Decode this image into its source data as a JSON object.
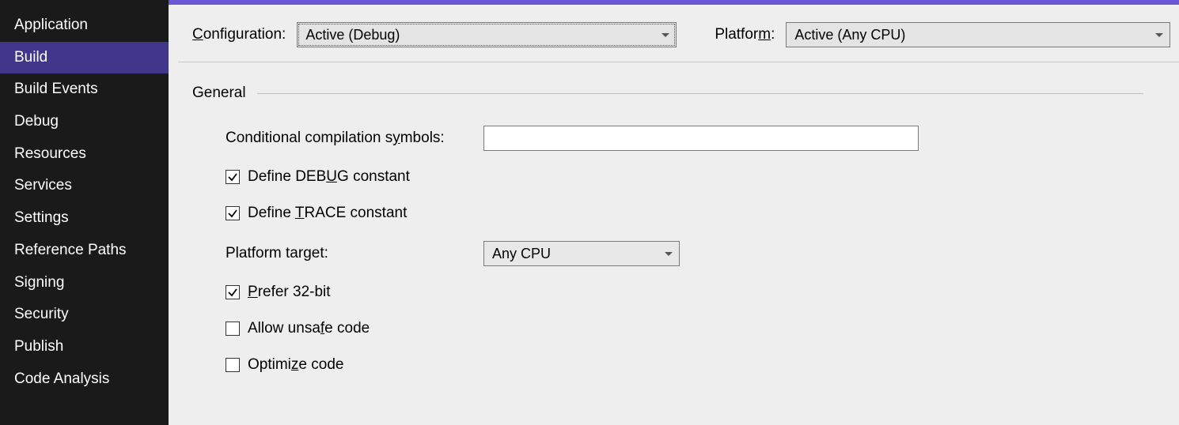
{
  "sidebar": {
    "items": [
      {
        "label": "Application",
        "active": false
      },
      {
        "label": "Build",
        "active": true
      },
      {
        "label": "Build Events",
        "active": false
      },
      {
        "label": "Debug",
        "active": false
      },
      {
        "label": "Resources",
        "active": false
      },
      {
        "label": "Services",
        "active": false
      },
      {
        "label": "Settings",
        "active": false
      },
      {
        "label": "Reference Paths",
        "active": false
      },
      {
        "label": "Signing",
        "active": false
      },
      {
        "label": "Security",
        "active": false
      },
      {
        "label": "Publish",
        "active": false
      },
      {
        "label": "Code Analysis",
        "active": false
      }
    ]
  },
  "configRow": {
    "configurationLabel_pre": "C",
    "configurationLabel_post": "onfiguration:",
    "configurationValue": "Active (Debug)",
    "platformLabel_pre": "Platfor",
    "platformLabel_post": ":",
    "platformLabel_ul": "m",
    "platformValue": "Active (Any CPU)"
  },
  "section": {
    "title": "General",
    "conditionalLabel_pre": "Conditional compilation s",
    "conditionalLabel_ul": "y",
    "conditionalLabel_post": "mbols:",
    "conditionalValue": "",
    "defineDebug_pre": "Define DEB",
    "defineDebug_ul": "U",
    "defineDebug_post": "G constant",
    "defineDebug_checked": true,
    "defineTrace_pre": "Define ",
    "defineTrace_ul": "T",
    "defineTrace_post": "RACE constant",
    "defineTrace_checked": true,
    "platformTarget_pre": "Platform tar",
    "platformTarget_ul": "g",
    "platformTarget_post": "et:",
    "platformTargetValue": "Any CPU",
    "prefer32_pre": "",
    "prefer32_ul": "P",
    "prefer32_post": "refer 32-bit",
    "prefer32_checked": true,
    "allowUnsafe_pre": "Allow unsa",
    "allowUnsafe_ul": "f",
    "allowUnsafe_post": "e code",
    "allowUnsafe_checked": false,
    "optimize_pre": "Optimi",
    "optimize_ul": "z",
    "optimize_post": "e code",
    "optimize_checked": false
  }
}
